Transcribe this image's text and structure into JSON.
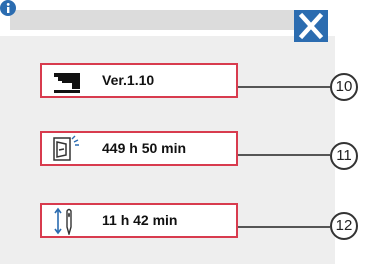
{
  "header": {
    "info_icon": "info-icon",
    "close_icon": "close-icon",
    "accent_color": "#2b6cb0"
  },
  "items": [
    {
      "icon": "sewing-machine-icon",
      "value": "Ver.1.10",
      "callout": "10"
    },
    {
      "icon": "power-switch-icon",
      "value": "449 h 50 min",
      "callout": "11"
    },
    {
      "icon": "needle-icon",
      "value": "11 h 42 min",
      "callout": "12"
    }
  ],
  "border_color": "#d83b4e"
}
